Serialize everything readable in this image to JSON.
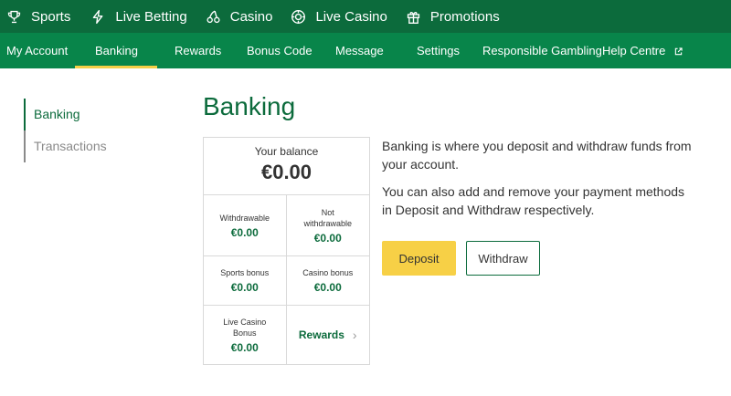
{
  "topnav": {
    "items": [
      {
        "label": "Sports",
        "icon": "trophy-icon"
      },
      {
        "label": "Live Betting",
        "icon": "lightning-icon"
      },
      {
        "label": "Casino",
        "icon": "cherries-icon"
      },
      {
        "label": "Live Casino",
        "icon": "casino-chip-icon"
      },
      {
        "label": "Promotions",
        "icon": "gift-icon"
      }
    ]
  },
  "subnav": {
    "tabs": [
      {
        "label": "My Account"
      },
      {
        "label": "Banking",
        "active": true
      },
      {
        "label": "Rewards"
      },
      {
        "label": "Bonus Code"
      },
      {
        "label": "Message"
      },
      {
        "label": "Settings"
      },
      {
        "label": "Responsible Gambling"
      },
      {
        "label": "Help Centre",
        "icon": "external-link-icon"
      }
    ]
  },
  "sidebar": {
    "items": [
      {
        "label": "Banking",
        "active": true
      },
      {
        "label": "Transactions",
        "active": false
      }
    ]
  },
  "main": {
    "title": "Banking",
    "balance": {
      "label": "Your balance",
      "amount": "€0.00",
      "withdrawable_label": "Withdrawable",
      "withdrawable_value": "€0.00",
      "not_withdrawable_label_1": "Not",
      "not_withdrawable_label_2": "withdrawable",
      "not_withdrawable_value": "€0.00",
      "sports_bonus_label": "Sports bonus",
      "sports_bonus_value": "€0.00",
      "casino_bonus_label": "Casino bonus",
      "casino_bonus_value": "€0.00",
      "live_casino_label_1": "Live Casino",
      "live_casino_label_2": "Bonus",
      "live_casino_value": "€0.00",
      "rewards_link": "Rewards"
    },
    "description": [
      "Banking is where you deposit and withdraw funds from your account.",
      "You can also add and remove your payment methods in Deposit and Withdraw respectively."
    ],
    "deposit_label": "Deposit",
    "withdraw_label": "Withdraw"
  },
  "colors": {
    "topnav_bg": "#0c6b3c",
    "subnav_bg": "#08854a",
    "accent_yellow": "#f7d046",
    "brand_green": "#0c6b3c"
  }
}
